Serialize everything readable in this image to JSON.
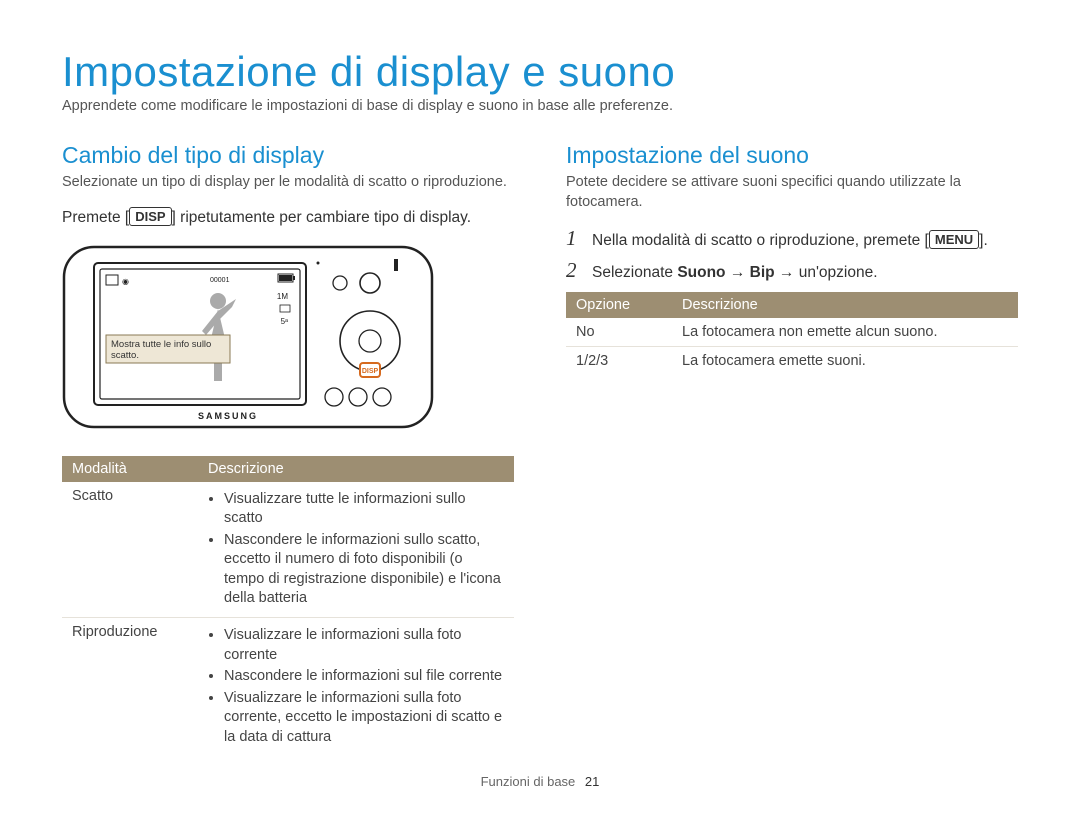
{
  "title": "Impostazione di display e suono",
  "subtitle": "Apprendete come modificare le impostazioni di base di display e suono in base alle preferenze.",
  "left": {
    "heading": "Cambio del tipo di display",
    "sub": "Selezionate un tipo di display per le modalità di scatto o riproduzione.",
    "instr_pre": "Premete [",
    "instr_key": "DISP",
    "instr_post": "] ripetutamente per cambiare tipo di display.",
    "camera": {
      "counter": "00001",
      "callout_l1": "Mostra tutte le info sullo",
      "callout_l2": "scatto.",
      "key": "DISP",
      "brand": "SAMSUNG"
    },
    "table": {
      "h1": "Modalità",
      "h2": "Descrizione",
      "rows": [
        {
          "mode": "Scatto",
          "bullets": [
            "Visualizzare tutte le informazioni sullo scatto",
            "Nascondere le informazioni sullo scatto, eccetto il numero di foto disponibili (o tempo di registrazione disponibile) e l'icona della batteria"
          ]
        },
        {
          "mode": "Riproduzione",
          "bullets": [
            "Visualizzare le informazioni sulla foto corrente",
            "Nascondere le informazioni sul file corrente",
            "Visualizzare le informazioni sulla foto corrente, eccetto le impostazioni di scatto e la data di cattura"
          ]
        }
      ]
    }
  },
  "right": {
    "heading": "Impostazione del suono",
    "sub": "Potete decidere se attivare suoni specifici quando utilizzate la fotocamera.",
    "steps": [
      {
        "n": "1",
        "pre": "Nella modalità di scatto o riproduzione, premete [",
        "key": "MENU",
        "post": "]."
      },
      {
        "n": "2",
        "pre": "Selezionate ",
        "boldpath": "Suono → Bip",
        "post": " → un'opzione."
      }
    ],
    "table": {
      "h1": "Opzione",
      "h2": "Descrizione",
      "rows": [
        {
          "opt": "No",
          "desc": "La fotocamera non emette alcun suono."
        },
        {
          "opt": "1/2/3",
          "desc": "La fotocamera emette suoni."
        }
      ]
    }
  },
  "footer": {
    "label": "Funzioni di base",
    "page": "21"
  }
}
